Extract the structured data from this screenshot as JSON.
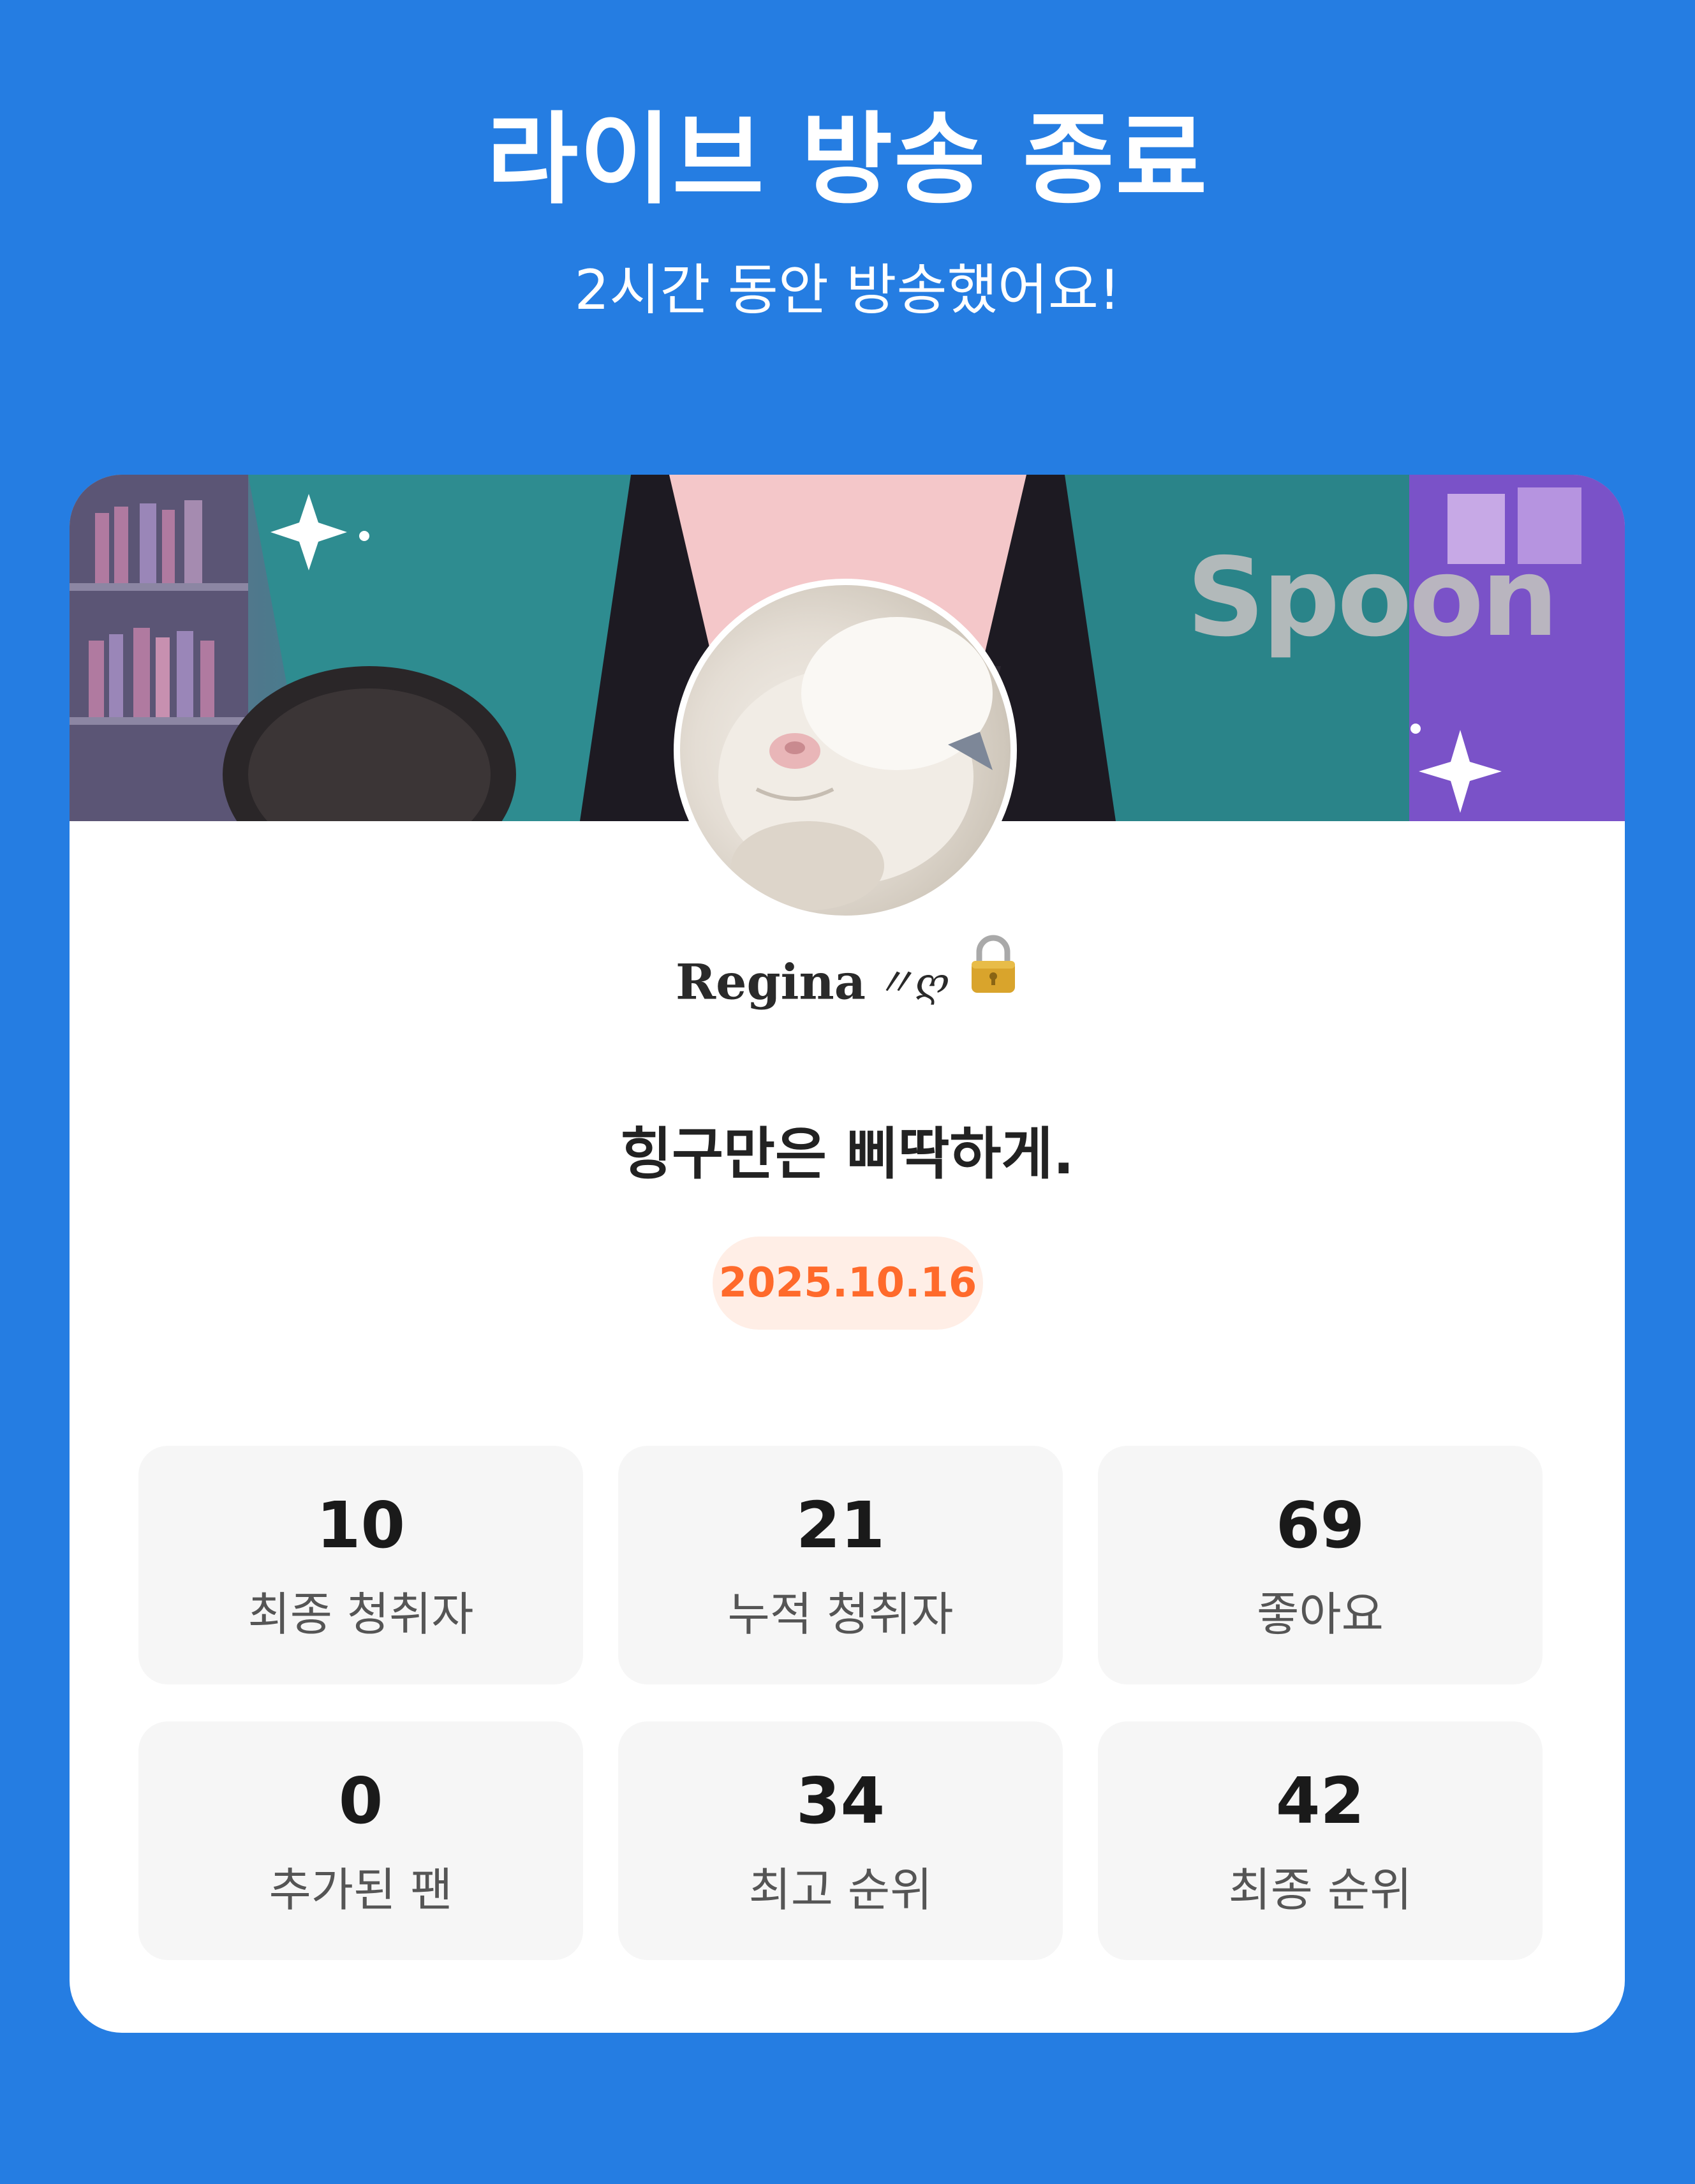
{
  "header": {
    "title": "라이브 방송 종료",
    "subtitle": "2시간 동안 방송했어요!"
  },
  "card": {
    "banner": {
      "logo_text": "Spoon",
      "image": "anime-girl-with-headphones-illustration"
    },
    "avatar": {
      "image": "white-cat-photo"
    },
    "username": "Regina",
    "username_decoration": "〃ღ",
    "username_icon": "lock-icon",
    "headline": "힝구만은 삐딱하게.",
    "date": "2025.10.16",
    "stats": [
      {
        "value": "10",
        "label": "최종 청취자"
      },
      {
        "value": "21",
        "label": "누적 청취자"
      },
      {
        "value": "69",
        "label": "좋아요"
      },
      {
        "value": "0",
        "label": "추가된 팬"
      },
      {
        "value": "34",
        "label": "최고 순위"
      },
      {
        "value": "42",
        "label": "최종 순위"
      }
    ]
  },
  "colors": {
    "background": "#257DE2",
    "card": "#FFFFFF",
    "stat_tile": "#F6F6F6",
    "date_text": "#FF6A2B",
    "date_pill": "#FFEEE6"
  }
}
